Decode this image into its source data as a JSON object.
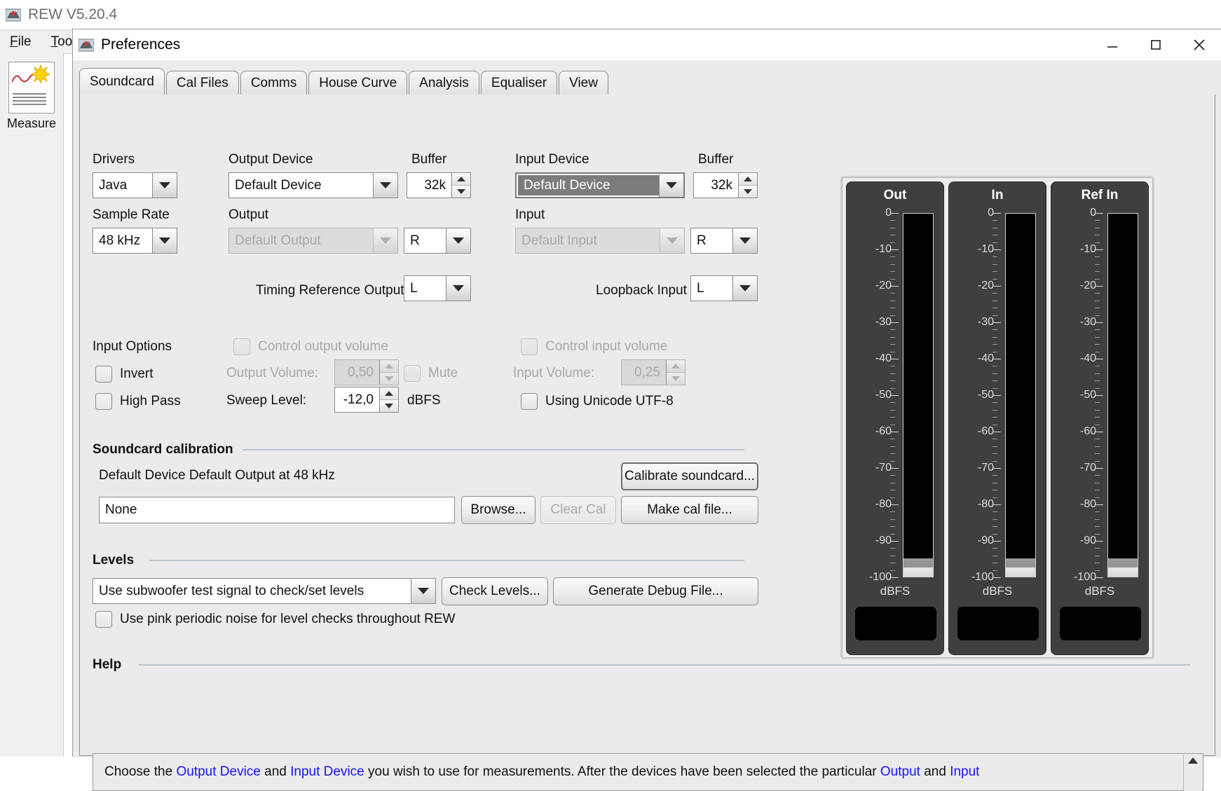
{
  "app": {
    "title": "REW V5.20.4",
    "icon": "rew-app-icon",
    "menus": [
      {
        "label": "File",
        "mnemonic": "F"
      },
      {
        "label": "Tool",
        "mnemonic": "T"
      }
    ],
    "sidebar": {
      "items": [
        {
          "label": "Measure",
          "icon": "measure-icon"
        }
      ]
    }
  },
  "dialog": {
    "title": "Preferences",
    "icon": "rew-app-icon",
    "window_buttons": [
      {
        "name": "minimize",
        "glyph": "minimize-icon"
      },
      {
        "name": "maximize",
        "glyph": "maximize-icon"
      },
      {
        "name": "close",
        "glyph": "close-icon"
      }
    ],
    "tabs": [
      {
        "label": "Soundcard",
        "active": true
      },
      {
        "label": "Cal Files",
        "active": false
      },
      {
        "label": "Comms",
        "active": false
      },
      {
        "label": "House Curve",
        "active": false
      },
      {
        "label": "Analysis",
        "active": false
      },
      {
        "label": "Equaliser",
        "active": false
      },
      {
        "label": "View",
        "active": false
      }
    ]
  },
  "soundcard": {
    "drivers": {
      "label": "Drivers",
      "value": "Java"
    },
    "sample_rate": {
      "label": "Sample Rate",
      "value": "48 kHz"
    },
    "output_device": {
      "label": "Output Device",
      "value": "Default Device"
    },
    "output_buffer": {
      "label": "Buffer",
      "value": "32k"
    },
    "output": {
      "label": "Output",
      "value": "Default Output",
      "disabled": true
    },
    "output_channel": {
      "value": "R"
    },
    "input_device": {
      "label": "Input Device",
      "value": "Default Device",
      "focused": true
    },
    "input_buffer": {
      "label": "Buffer",
      "value": "32k"
    },
    "input": {
      "label": "Input",
      "value": "Default Input",
      "disabled": true
    },
    "input_channel": {
      "value": "R"
    },
    "timing_reference_output": {
      "label": "Timing Reference Output",
      "value": "L"
    },
    "loopback_input": {
      "label": "Loopback Input",
      "value": "L"
    },
    "input_options": {
      "label": "Input Options",
      "invert": {
        "label": "Invert",
        "checked": false
      },
      "high_pass": {
        "label": "High Pass",
        "checked": false
      }
    },
    "control_output_volume": {
      "label": "Control output volume",
      "checked": false,
      "disabled": true
    },
    "output_volume": {
      "label": "Output Volume:",
      "value": "0,50",
      "disabled": true
    },
    "mute": {
      "label": "Mute",
      "checked": false,
      "disabled": true
    },
    "control_input_volume": {
      "label": "Control input volume",
      "checked": false,
      "disabled": true
    },
    "input_volume": {
      "label": "Input Volume:",
      "value": "0,25",
      "disabled": true
    },
    "sweep_level": {
      "label": "Sweep Level:",
      "value": "-12,0",
      "units": "dBFS"
    },
    "using_unicode": {
      "label": "Using Unicode UTF-8",
      "checked": false
    }
  },
  "calibration": {
    "section_title": "Soundcard calibration",
    "description": "Default Device Default Output at 48 kHz",
    "cal_file": {
      "value": "None"
    },
    "browse_button": "Browse...",
    "clear_cal_button": {
      "label": "Clear Cal",
      "disabled": true
    },
    "calibrate_button": "Calibrate soundcard...",
    "make_cal_button": "Make cal file..."
  },
  "levels": {
    "section_title": "Levels",
    "test_signal": {
      "value": "Use subwoofer test signal to check/set levels"
    },
    "check_levels_button": "Check Levels...",
    "generate_debug_button": "Generate Debug File...",
    "pink_noise": {
      "label": "Use pink periodic noise for level checks throughout REW",
      "checked": false
    }
  },
  "help": {
    "section_title": "Help",
    "parts": [
      {
        "text": "Choose the ",
        "link": false
      },
      {
        "text": "Output Device",
        "link": true
      },
      {
        "text": " and ",
        "link": false
      },
      {
        "text": "Input Device",
        "link": true
      },
      {
        "text": " you wish to use for measurements. After the devices have been selected the particular ",
        "link": false
      },
      {
        "text": "Output",
        "link": true
      },
      {
        "text": " and ",
        "link": false
      },
      {
        "text": "Input",
        "link": true
      }
    ],
    "scroll_up_icon": "scroll-up-icon"
  },
  "meters": {
    "units": "dBFS",
    "scale_labels": [
      "0",
      "-10",
      "-20",
      "-30",
      "-40",
      "-50",
      "-60",
      "-70",
      "-80",
      "-90",
      "-100"
    ],
    "channels": [
      {
        "title": "Out",
        "level_db": -100
      },
      {
        "title": "In",
        "level_db": -100
      },
      {
        "title": "Ref In",
        "level_db": -100
      }
    ]
  },
  "colors": {
    "dialog_bg": "#eceaea",
    "meter_bg": "#3f3f3f",
    "link": "#1414ff",
    "selection": "#7c7c7c"
  }
}
